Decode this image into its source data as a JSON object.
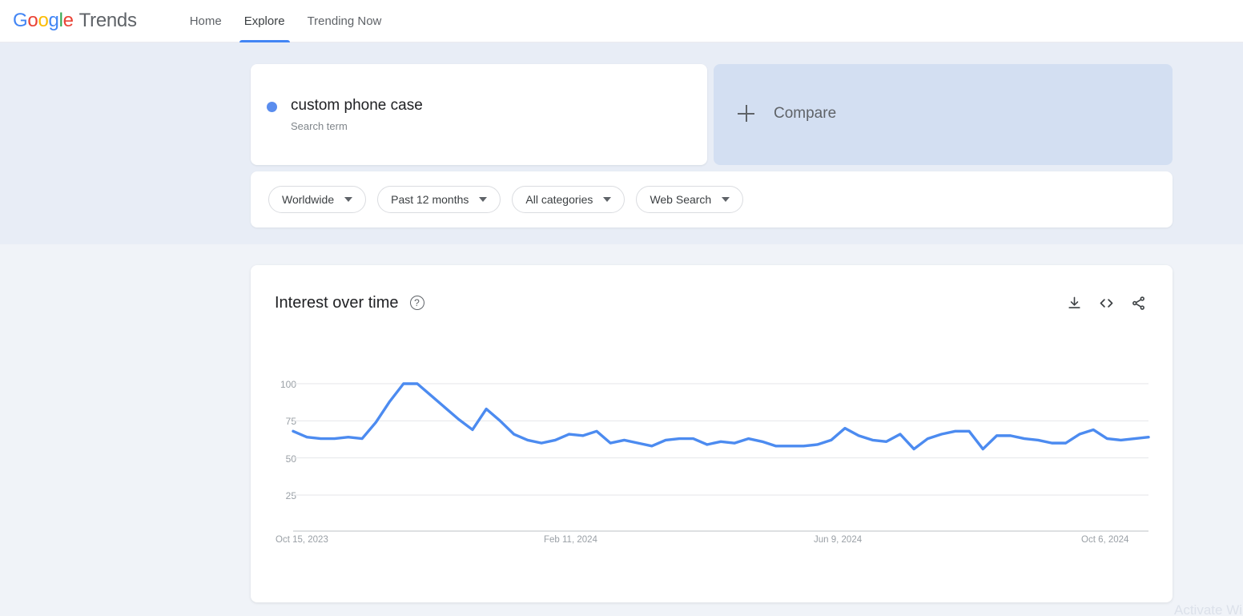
{
  "header": {
    "logo": {
      "word": "Google",
      "letters": [
        "G",
        "o",
        "o",
        "g",
        "l",
        "e"
      ],
      "product": "Trends"
    },
    "nav": [
      {
        "label": "Home",
        "active": false
      },
      {
        "label": "Explore",
        "active": true
      },
      {
        "label": "Trending Now",
        "active": false
      }
    ]
  },
  "query": {
    "term": {
      "name": "custom phone case",
      "type": "Search term",
      "color": "#5A8DEE"
    },
    "compare": {
      "label": "Compare",
      "icon": "plus-icon"
    }
  },
  "filters": [
    {
      "label": "Worldwide",
      "name": "location"
    },
    {
      "label": "Past 12 months",
      "name": "time-range"
    },
    {
      "label": "All categories",
      "name": "category"
    },
    {
      "label": "Web Search",
      "name": "search-type"
    }
  ],
  "chart_card": {
    "title": "Interest over time",
    "help_icon": "help-circle-icon",
    "actions": [
      {
        "name": "download-icon",
        "label": "Download"
      },
      {
        "name": "embed-code-icon",
        "label": "Embed"
      },
      {
        "name": "share-icon",
        "label": "Share"
      }
    ]
  },
  "chart_data": {
    "type": "line",
    "title": "Interest over time",
    "xlabel": "",
    "ylabel": "",
    "ylim": [
      0,
      100
    ],
    "yticks": [
      100,
      75,
      50,
      25
    ],
    "grid": true,
    "legend": false,
    "line_color": "#4C8BF0",
    "xtick_labels": [
      "Oct 15, 2023",
      "Feb 11, 2024",
      "Jun 9, 2024",
      "Oct 6, 2024"
    ],
    "series": [
      {
        "name": "custom phone case",
        "values": [
          68,
          64,
          63,
          63,
          64,
          63,
          74,
          88,
          100,
          100,
          92,
          84,
          76,
          69,
          83,
          75,
          66,
          62,
          60,
          62,
          66,
          65,
          68,
          60,
          62,
          60,
          58,
          62,
          63,
          63,
          59,
          61,
          60,
          63,
          61,
          58,
          58,
          58,
          59,
          62,
          70,
          65,
          62,
          61,
          66,
          56,
          63,
          66,
          68,
          68,
          56,
          65,
          65,
          63,
          62,
          60,
          60,
          66,
          69,
          63,
          62,
          63,
          64
        ]
      }
    ]
  },
  "watermark": {
    "text": "Activate Windows"
  }
}
